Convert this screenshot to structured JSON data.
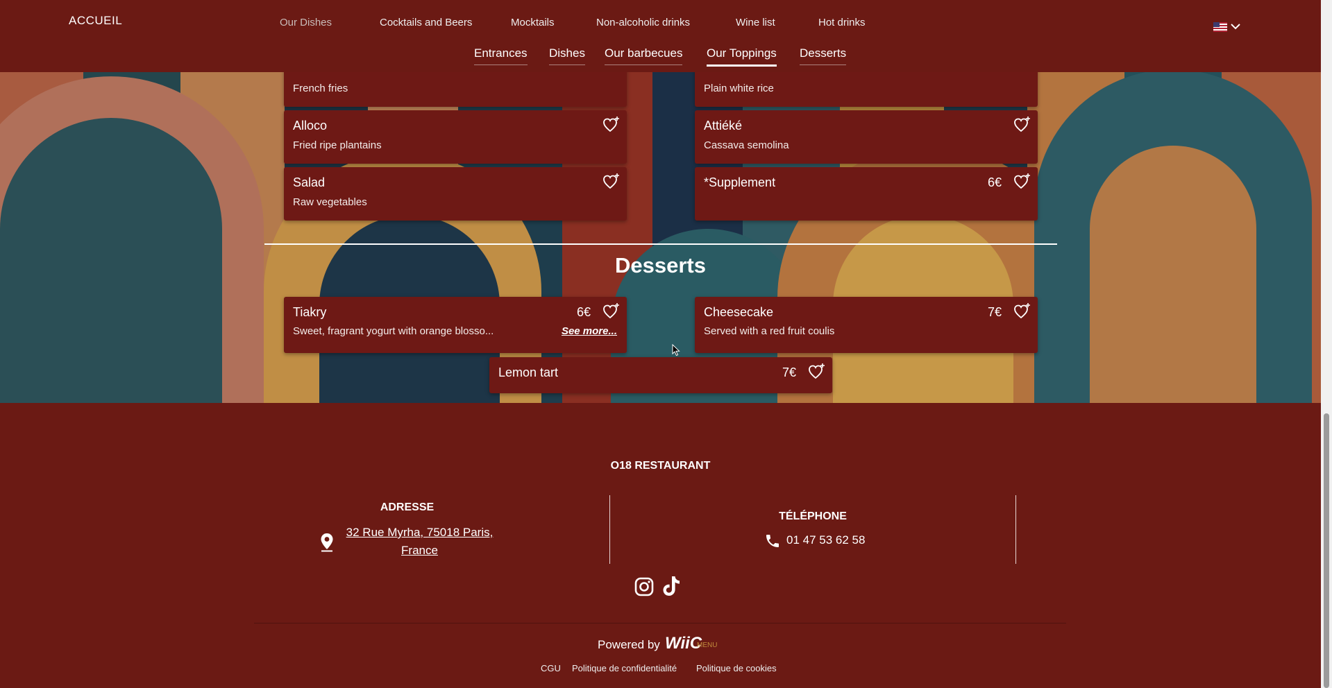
{
  "header": {
    "home": "ACCUEIL",
    "nav": [
      "Our Dishes",
      "Cocktails and Beers",
      "Mocktails",
      "Non-alcoholic drinks",
      "Wine list",
      "Hot drinks"
    ],
    "subnav": [
      "Entrances",
      "Dishes",
      "Our barbecues",
      "Our Toppings",
      "Desserts"
    ],
    "language_flag": "flag-us-icon"
  },
  "toppings": [
    {
      "name": "",
      "desc": "French fries"
    },
    {
      "name": "",
      "desc": "Plain white rice"
    },
    {
      "name": "Alloco",
      "desc": "Fried ripe plantains"
    },
    {
      "name": "Attiéké",
      "desc": "Cassava semolina"
    },
    {
      "name": "Salad",
      "desc": "Raw vegetables"
    },
    {
      "name": "*Supplement",
      "desc": "",
      "price": "6€"
    }
  ],
  "desserts": {
    "title": "Desserts",
    "items": [
      {
        "name": "Tiakry",
        "desc": "Sweet, fragrant yogurt with orange blosso...",
        "price": "6€",
        "more": "See more..."
      },
      {
        "name": "Cheesecake",
        "desc": "Served with a red fruit coulis",
        "price": "7€"
      },
      {
        "name": "Lemon tart",
        "price": "7€"
      }
    ]
  },
  "footer": {
    "restaurant": "O18 RESTAURANT",
    "address_title": "ADRESSE",
    "address_line1": "32 Rue Myrha, 75018 Paris,",
    "address_line2": "France",
    "phone_title": "TÉLÉPHONE",
    "phone": "01 47 53 62 58",
    "powered_by": "Powered by",
    "brand": "WiiC",
    "brand_sub": "MENU",
    "legal": [
      "CGU",
      "Politique de confidentialité",
      "Politique de cookies"
    ]
  },
  "colors": {
    "background": "#6b1a14",
    "card": "#6e1915",
    "text": "#ffffff",
    "brand_accent": "#c08a3b"
  }
}
